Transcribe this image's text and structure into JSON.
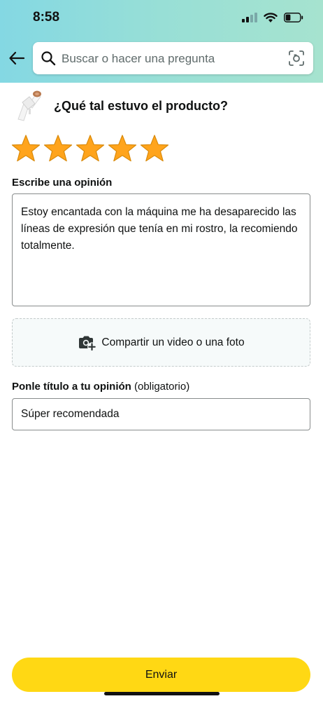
{
  "status_bar": {
    "time": "8:58",
    "signal_bars": 4,
    "signal_bars_active": 2,
    "battery_level": 0.35
  },
  "header": {
    "back_icon": "arrow-left-icon",
    "search_placeholder": "Buscar o hacer una pregunta",
    "search_icon": "search-icon",
    "camera_search_icon": "lens-icon",
    "gradient_colors": [
      "#84d8e3",
      "#a6e3cf"
    ]
  },
  "product": {
    "question": "¿Qué tal estuvo el producto?"
  },
  "rating": {
    "value": 5,
    "max": 5,
    "star_color": "#ffa41c"
  },
  "review": {
    "label": "Escribe una opinión",
    "text": "Estoy encantada con la máquina me ha desaparecido las líneas de expresión que tenía en mi rostro, la recomiendo totalmente."
  },
  "media": {
    "icon": "camera-plus-icon",
    "label": "Compartir un video o una foto"
  },
  "title_field": {
    "label": "Ponle título a tu opinión",
    "required_note": "(obligatorio)",
    "value": "Súper recomendada"
  },
  "submit": {
    "label": "Enviar",
    "color": "#ffd814"
  }
}
